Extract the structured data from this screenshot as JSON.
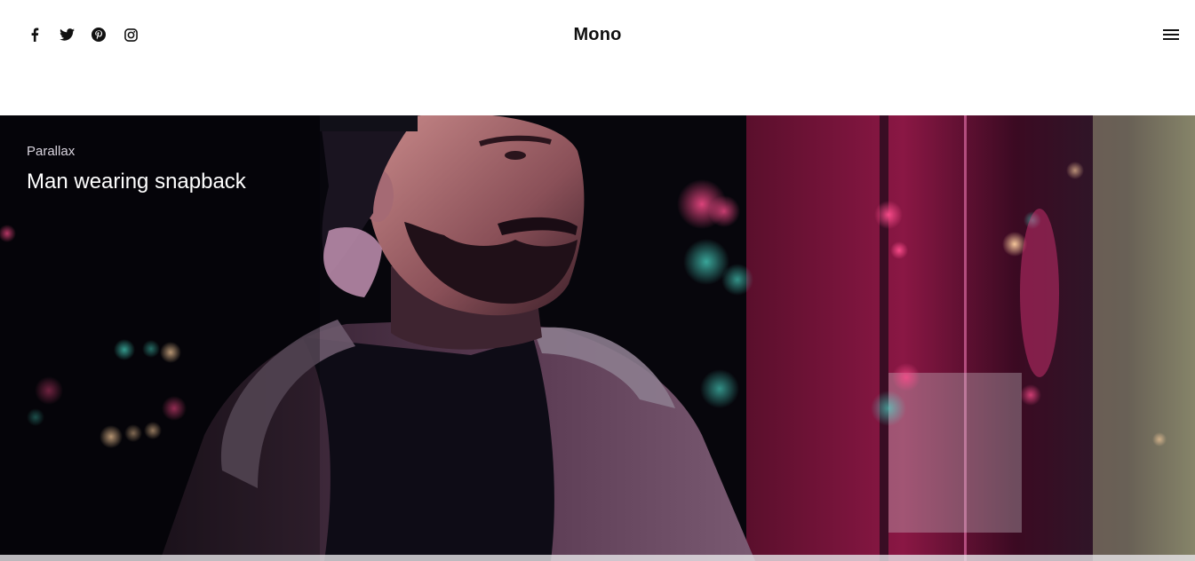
{
  "header": {
    "logo": "Mono",
    "social": [
      {
        "icon": "facebook-icon"
      },
      {
        "icon": "twitter-icon"
      },
      {
        "icon": "pinterest-icon"
      },
      {
        "icon": "instagram-icon"
      }
    ],
    "menu_icon": "hamburger-menu-icon"
  },
  "hero": {
    "kicker": "Parallax",
    "title": "Man wearing snapback",
    "image_subject": "man in snapback cap and hooded jacket at night with neon lights"
  },
  "colors": {
    "header_bg": "#ffffff",
    "text_dark": "#111111",
    "hero_text": "#ffffff",
    "neon_pink": "#c2185b",
    "neon_teal": "#2ec4b6"
  }
}
